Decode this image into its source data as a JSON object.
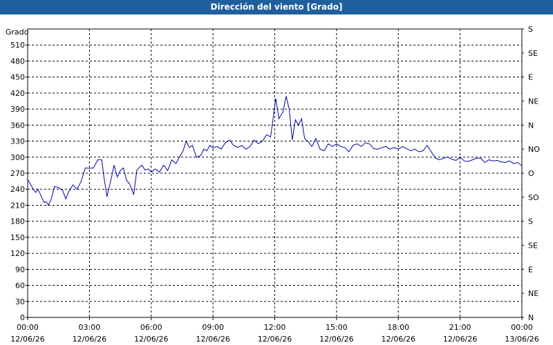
{
  "window": {
    "title": "Dirección del viento [Grado]"
  },
  "chart_data": {
    "type": "line",
    "title": "Dirección del viento [Grado]",
    "ylabel": "Grado",
    "ylim": [
      0,
      540
    ],
    "y_ticks": [
      0,
      30,
      60,
      90,
      120,
      150,
      180,
      210,
      240,
      270,
      300,
      330,
      360,
      390,
      420,
      450,
      480,
      510
    ],
    "right_axis_labels": [
      "N",
      "NE",
      "E",
      "SE",
      "S",
      "SO",
      "O",
      "NO",
      "N",
      "NE",
      "E",
      "SE",
      "S"
    ],
    "right_axis_values": [
      0,
      45,
      90,
      135,
      180,
      225,
      270,
      315,
      360,
      405,
      450,
      495,
      540
    ],
    "x_ticks": [
      {
        "time": "00:00",
        "date": "12/06/26",
        "hour": 0
      },
      {
        "time": "03:00",
        "date": "12/06/26",
        "hour": 3
      },
      {
        "time": "06:00",
        "date": "12/06/26",
        "hour": 6
      },
      {
        "time": "09:00",
        "date": "12/06/26",
        "hour": 9
      },
      {
        "time": "12:00",
        "date": "12/06/26",
        "hour": 12
      },
      {
        "time": "15:00",
        "date": "12/06/26",
        "hour": 15
      },
      {
        "time": "18:00",
        "date": "12/06/26",
        "hour": 18
      },
      {
        "time": "21:00",
        "date": "12/06/26",
        "hour": 21
      },
      {
        "time": "00:00",
        "date": "13/06/26",
        "hour": 24
      }
    ],
    "xlim_hours": [
      0,
      24
    ],
    "grid": true,
    "line_color": "#0000aa",
    "series": [
      {
        "x_hours": [
          0.0,
          0.25,
          0.4,
          0.5,
          0.6,
          0.8,
          0.9,
          1.0,
          1.15,
          1.3,
          1.5,
          1.7,
          1.85,
          2.0,
          2.2,
          2.4,
          2.6,
          2.8,
          3.0,
          3.2,
          3.4,
          3.6,
          3.7,
          3.85,
          4.0,
          4.2,
          4.35,
          4.5,
          4.65,
          4.8,
          4.95,
          5.15,
          5.3,
          5.4,
          5.55,
          5.7,
          5.85,
          6.0,
          6.2,
          6.4,
          6.6,
          6.8,
          7.0,
          7.2,
          7.4,
          7.55,
          7.7,
          7.85,
          8.0,
          8.2,
          8.4,
          8.55,
          8.7,
          8.85,
          9.0,
          9.2,
          9.4,
          9.6,
          9.8,
          10.0,
          10.2,
          10.4,
          10.6,
          10.8,
          11.0,
          11.2,
          11.4,
          11.6,
          11.8,
          11.95,
          12.05,
          12.2,
          12.4,
          12.55,
          12.7,
          12.85,
          13.0,
          13.15,
          13.3,
          13.45,
          13.6,
          13.8,
          14.0,
          14.2,
          14.4,
          14.6,
          14.8,
          15.0,
          15.2,
          15.4,
          15.6,
          15.8,
          16.0,
          16.2,
          16.4,
          16.6,
          16.8,
          17.0,
          17.2,
          17.4,
          17.6,
          17.8,
          18.0,
          18.2,
          18.4,
          18.6,
          18.8,
          19.0,
          19.2,
          19.4,
          19.6,
          19.8,
          20.0,
          20.2,
          20.4,
          20.6,
          20.8,
          21.0,
          21.2,
          21.4,
          21.6,
          21.8,
          22.0,
          22.2,
          22.4,
          22.6,
          22.8,
          23.0,
          23.2,
          23.4,
          23.6,
          23.8,
          24.0
        ],
        "values": [
          258,
          242,
          234,
          240,
          232,
          215,
          217,
          210,
          222,
          245,
          243,
          238,
          222,
          236,
          248,
          240,
          255,
          280,
          279,
          280,
          295,
          295,
          264,
          226,
          250,
          285,
          263,
          275,
          280,
          257,
          250,
          230,
          275,
          280,
          285,
          276,
          278,
          272,
          278,
          272,
          285,
          275,
          295,
          288,
          302,
          312,
          330,
          318,
          322,
          300,
          303,
          315,
          312,
          322,
          317,
          320,
          315,
          327,
          332,
          322,
          318,
          322,
          315,
          320,
          332,
          325,
          330,
          342,
          338,
          382,
          410,
          372,
          385,
          414,
          390,
          332,
          370,
          360,
          372,
          335,
          330,
          320,
          335,
          315,
          312,
          325,
          320,
          325,
          320,
          318,
          310,
          322,
          325,
          320,
          327,
          325,
          316,
          315,
          318,
          320,
          315,
          318,
          315,
          320,
          316,
          312,
          315,
          310,
          312,
          322,
          310,
          298,
          295,
          298,
          300,
          296,
          294,
          300,
          293,
          292,
          295,
          298,
          298,
          290,
          295,
          293,
          294,
          291,
          290,
          293,
          288,
          290,
          284,
          286,
          282,
          288,
          285,
          290,
          295,
          298,
          305,
          288,
          286,
          282,
          284,
          280,
          285,
          282,
          286,
          288,
          292
        ]
      }
    ]
  }
}
